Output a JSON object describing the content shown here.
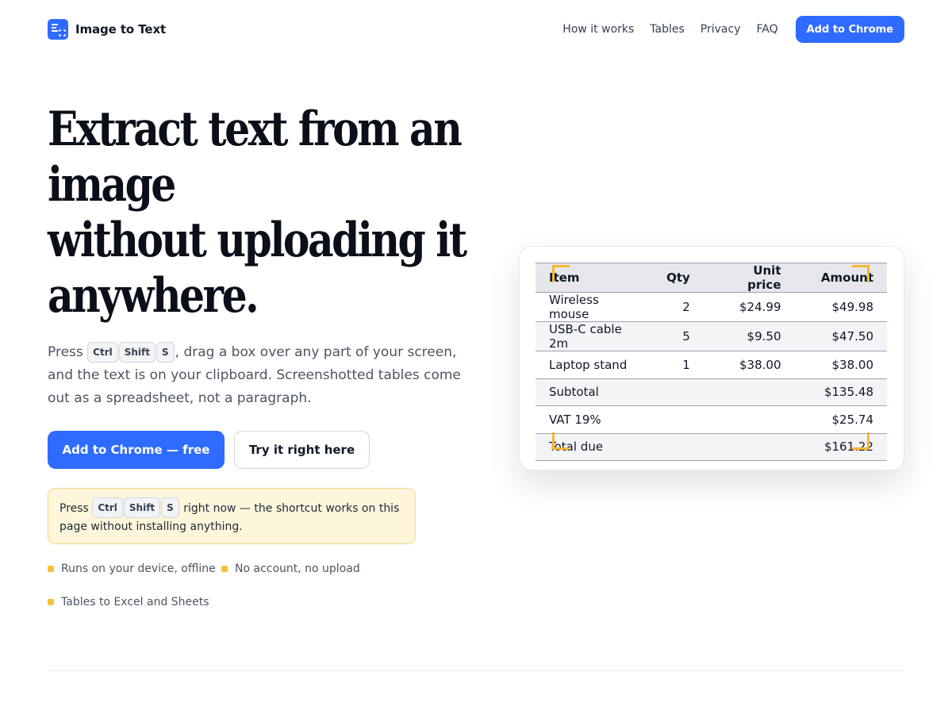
{
  "brand": {
    "name": "Image to Text",
    "logo_icon": "document-scan-icon",
    "accent": "#2f6bff"
  },
  "nav": {
    "links": [
      "How it works",
      "Tables",
      "Privacy",
      "FAQ"
    ],
    "cta": "Add to Chrome"
  },
  "hero": {
    "title_lines": [
      "Extract text from an",
      "image",
      "without uploading it",
      "anywhere."
    ],
    "subtitle": {
      "before": "Press",
      "keys": [
        "Ctrl",
        "Shift",
        "S"
      ],
      "after": ", drag a box over any part of your screen, and the text is on your clipboard. Screenshotted tables come out as a spreadsheet, not a paragraph."
    },
    "primary_button": "Add to Chrome — free",
    "secondary_button": "Try it right here"
  },
  "tip": {
    "before": "Press",
    "keys": [
      "Ctrl",
      "Shift",
      "S"
    ],
    "after": "right now — the shortcut works on this page without installing anything.",
    "background": "#fef6db"
  },
  "features": [
    "Runs on your device, offline",
    "No account, no upload",
    "Tables to Excel and Sheets"
  ],
  "feature_bullet_color": "#f5c038",
  "table": {
    "headers": [
      "Item",
      "Qty",
      "Unit price",
      "Amount"
    ],
    "rows": [
      [
        "Wireless mouse",
        "2",
        "$24.99",
        "$49.98"
      ],
      [
        "USB-C cable 2m",
        "5",
        "$9.50",
        "$47.50"
      ],
      [
        "Laptop stand",
        "1",
        "$38.00",
        "$38.00"
      ],
      [
        "Subtotal",
        "",
        "",
        "$135.48"
      ],
      [
        "VAT 19%",
        "",
        "",
        "$25.74"
      ],
      [
        "Total due",
        "",
        "",
        "$161.22"
      ]
    ],
    "selection_color": "#f5b731"
  }
}
